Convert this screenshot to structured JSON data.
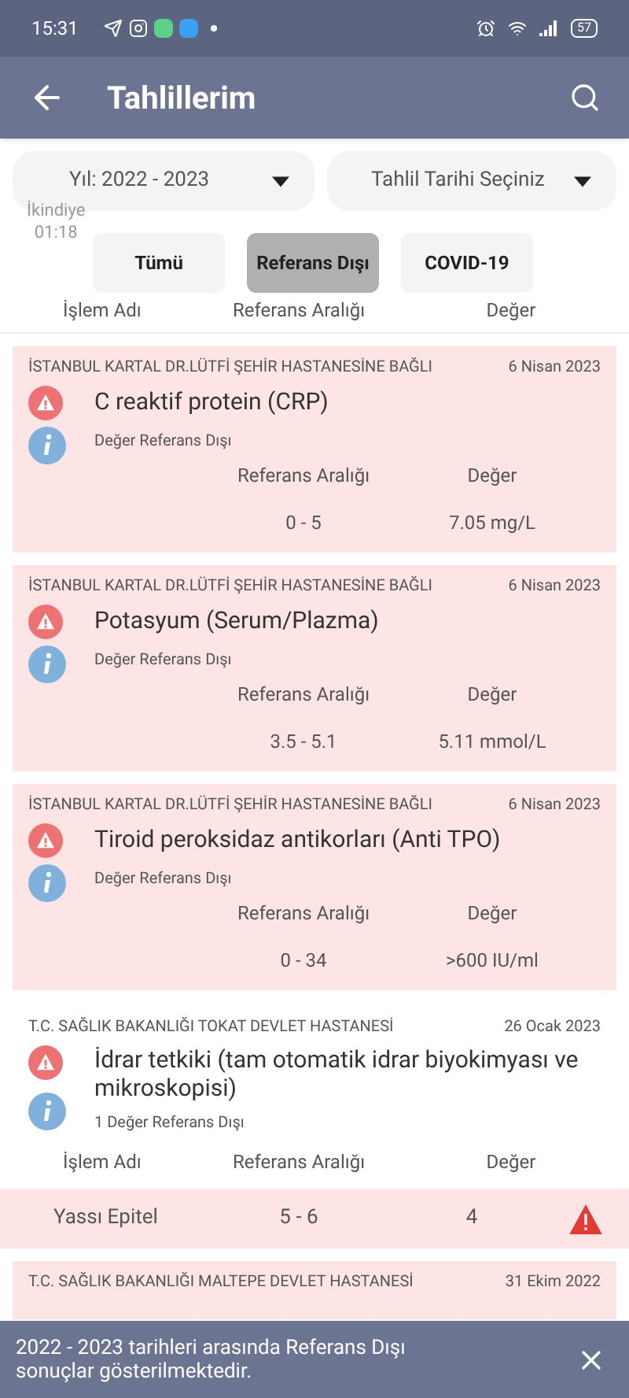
{
  "status_bar": {
    "time": "15:31",
    "battery": "57"
  },
  "app_bar": {
    "title": "Tahlillerim"
  },
  "filters": {
    "year": "Yıl: 2022 - 2023",
    "date": "Tahlil Tarihi Seçiniz"
  },
  "overlay": {
    "label": "İkindiye",
    "time": "01:18"
  },
  "tabs": [
    {
      "label": "Tümü",
      "selected": false
    },
    {
      "label": "Referans Dışı",
      "selected": true
    },
    {
      "label": "COVID-19",
      "selected": false
    }
  ],
  "columns": [
    "İşlem Adı",
    "Referans Aralığı",
    "Değer"
  ],
  "results": [
    {
      "kind": "single",
      "hospital": "İSTANBUL KARTAL DR.LÜTFİ ŞEHİR HASTANESİNE BAĞLI",
      "date": "6 Nisan 2023",
      "test": "C reaktif protein (CRP)",
      "note": "Değer Referans Dışı",
      "range_label": "Referans Aralığı",
      "value_label": "Değer",
      "range": "0 - 5",
      "value": "7.05 mg/L"
    },
    {
      "kind": "single",
      "hospital": "İSTANBUL KARTAL DR.LÜTFİ ŞEHİR HASTANESİNE BAĞLI",
      "date": "6 Nisan 2023",
      "test": "Potasyum (Serum/Plazma)",
      "note": "Değer Referans Dışı",
      "range_label": "Referans Aralığı",
      "value_label": "Değer",
      "range": "3.5 - 5.1",
      "value": "5.11 mmol/L"
    },
    {
      "kind": "single",
      "hospital": "İSTANBUL KARTAL DR.LÜTFİ ŞEHİR HASTANESİNE BAĞLI",
      "date": "6 Nisan 2023",
      "test": "Tiroid peroksidaz antikorları (Anti TPO)",
      "note": "Değer Referans Dışı",
      "range_label": "Referans Aralığı",
      "value_label": "Değer",
      "range": "0 - 34",
      "value": ">600 IU/ml"
    },
    {
      "kind": "multi",
      "hospital": "T.C. SAĞLIK BAKANLIĞI TOKAT DEVLET HASTANESİ",
      "date": "26 Ocak 2023",
      "test": "İdrar tetkiki (tam otomatik idrar biyokimyası ve mikroskopisi)",
      "note": "1 Değer Referans Dışı",
      "columns": [
        "İşlem Adı",
        "Referans Aralığı",
        "Değer"
      ],
      "rows": [
        {
          "name": "Yassı Epitel",
          "range": "5 - 6",
          "value": "4",
          "out_of_range": true
        }
      ]
    },
    {
      "kind": "header_only",
      "hospital": "T.C. SAĞLIK BAKANLIĞI MALTEPE DEVLET HASTANESİ",
      "date": "31 Ekim 2022"
    }
  ],
  "snackbar": {
    "message": "2022 - 2023 tarihleri arasında Referans Dışı sonuçlar gösterilmektedir."
  }
}
